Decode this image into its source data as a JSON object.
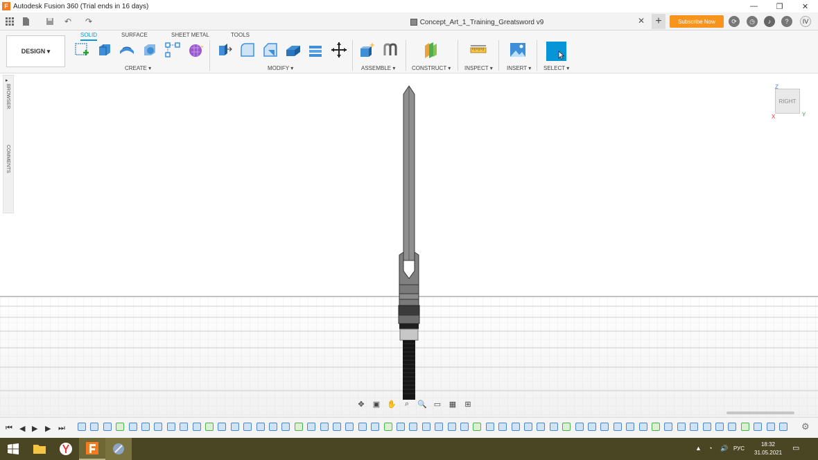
{
  "window": {
    "title": "Autodesk Fusion 360 (Trial ends in 16 days)",
    "controls": [
      "—",
      "❐",
      "✕"
    ]
  },
  "tabbar": {
    "document_title": "Concept_Art_1_Training_Greatsword v9",
    "close": "✕",
    "new_tab": "+",
    "subscribe_label": "Subscribe Now",
    "user_initials": "IV"
  },
  "ribbon": {
    "workspace": "DESIGN ▾",
    "tabs": [
      "SOLID",
      "SURFACE",
      "SHEET METAL",
      "TOOLS"
    ],
    "active_tab": "SOLID",
    "groups": [
      "CREATE ▾",
      "MODIFY ▾",
      "ASSEMBLE ▾",
      "CONSTRUCT ▾",
      "INSPECT ▾",
      "INSERT ▾",
      "SELECT ▾"
    ]
  },
  "sidepanel": {
    "browser": "BROWSER",
    "comments": "COMMENTS"
  },
  "viewcube": {
    "face": "RIGHT",
    "z": "Z",
    "y": "Y",
    "x": "X"
  },
  "taskbar": {
    "language": "РУС",
    "time": "18:32",
    "date": "31.05.2021"
  },
  "colors": {
    "accent": "#0696d7",
    "subscribe": "#f7941d",
    "taskbar": "#4a4522"
  }
}
